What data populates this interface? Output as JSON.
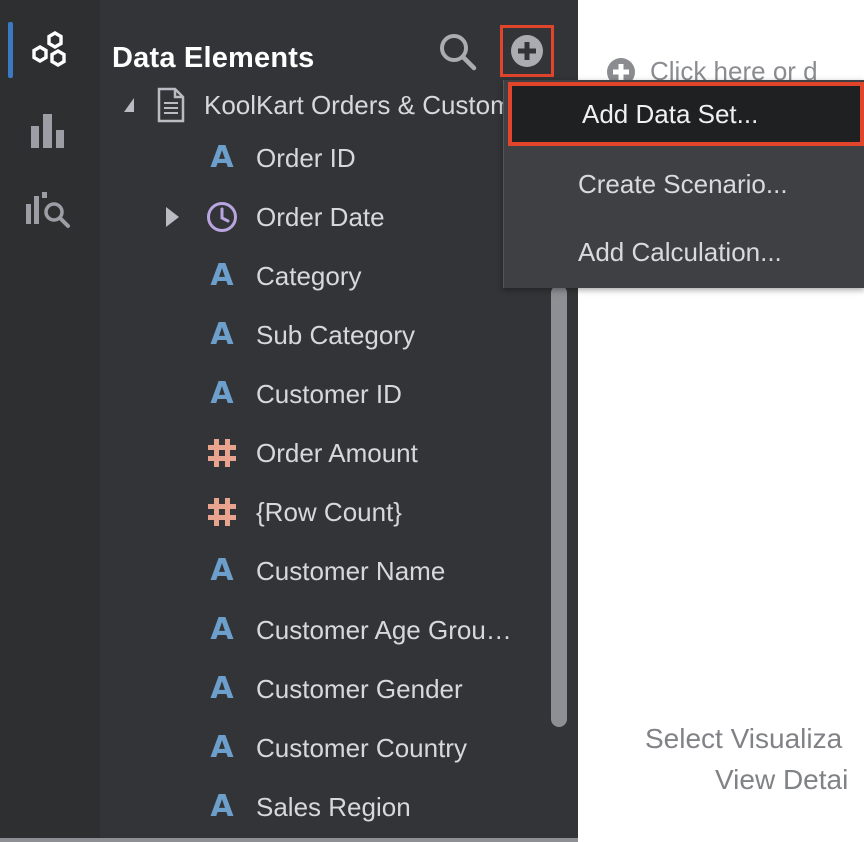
{
  "panel": {
    "title": "Data Elements",
    "dataset_label": "KoolKart Orders & Customers"
  },
  "tree_items": [
    {
      "label": "Order ID",
      "type": "text",
      "icon": "attribute-a-icon"
    },
    {
      "label": "Order Date",
      "type": "date",
      "icon": "clock-icon",
      "expandable": true
    },
    {
      "label": "Category",
      "type": "text",
      "icon": "attribute-a-icon"
    },
    {
      "label": "Sub Category",
      "type": "text",
      "icon": "attribute-a-icon"
    },
    {
      "label": "Customer ID",
      "type": "text",
      "icon": "attribute-a-icon"
    },
    {
      "label": "Order Amount",
      "type": "number",
      "icon": "hash-icon"
    },
    {
      "label": "{Row Count}",
      "type": "number",
      "icon": "hash-icon"
    },
    {
      "label": "Customer Name",
      "type": "text",
      "icon": "attribute-a-icon"
    },
    {
      "label": "Customer Age Grou…",
      "type": "text",
      "icon": "attribute-a-icon"
    },
    {
      "label": "Customer Gender",
      "type": "text",
      "icon": "attribute-a-icon"
    },
    {
      "label": "Customer Country",
      "type": "text",
      "icon": "attribute-a-icon"
    },
    {
      "label": "Sales Region",
      "type": "text",
      "icon": "attribute-a-icon"
    }
  ],
  "menu": {
    "items": [
      {
        "label": "Add Data Set...",
        "selected": true
      },
      {
        "label": "Create Scenario...",
        "selected": false
      },
      {
        "label": "Add Calculation...",
        "selected": false
      }
    ]
  },
  "canvas": {
    "hint": "Click here or d",
    "select_line1": "Select Visualiza",
    "select_line2": "View Detai"
  },
  "colors": {
    "highlight": "#e0442b",
    "text_attr": "#6c9fcc",
    "number_attr": "#e8a48f",
    "date_attr": "#b9a6e0",
    "active_rail": "#3b79c4"
  }
}
